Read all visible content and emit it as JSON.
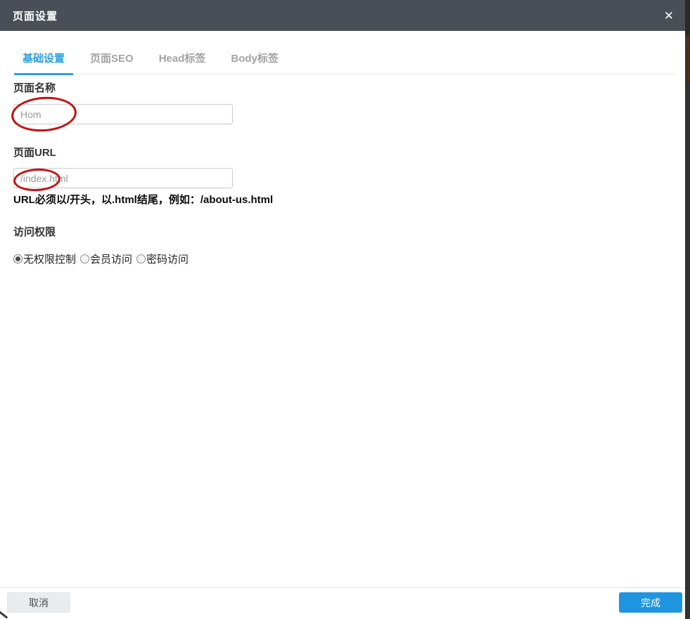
{
  "dialog": {
    "title": "页面设置",
    "close_icon": "✕"
  },
  "tabs": [
    {
      "label": "基础设置",
      "active": true
    },
    {
      "label": "页面SEO",
      "active": false
    },
    {
      "label": "Head标签",
      "active": false
    },
    {
      "label": "Body标签",
      "active": false
    }
  ],
  "form": {
    "page_name": {
      "label": "页面名称",
      "value": "Hom"
    },
    "page_url": {
      "label": "页面URL",
      "value": "/index.html",
      "hint": "URL必须以/开头，以.html结尾，例如：/about-us.html"
    },
    "access": {
      "label": "访问权限",
      "options": [
        {
          "label": "无权限控制",
          "selected": true
        },
        {
          "label": "会员访问",
          "selected": false
        },
        {
          "label": "密码访问",
          "selected": false
        }
      ]
    }
  },
  "footer": {
    "cancel_label": "取消",
    "done_label": "完成"
  },
  "annotations": {
    "type": "hand-drawn red ellipses",
    "color": "#c41111",
    "targets": [
      "page name value 'Hom'",
      "URL prefix '/index.'"
    ]
  },
  "colors": {
    "header_bg": "#494e57",
    "accent_blue": "#2a9fe0",
    "done_button": "#2095df",
    "cancel_button": "#eaebed",
    "annotation_red": "#c41111"
  }
}
